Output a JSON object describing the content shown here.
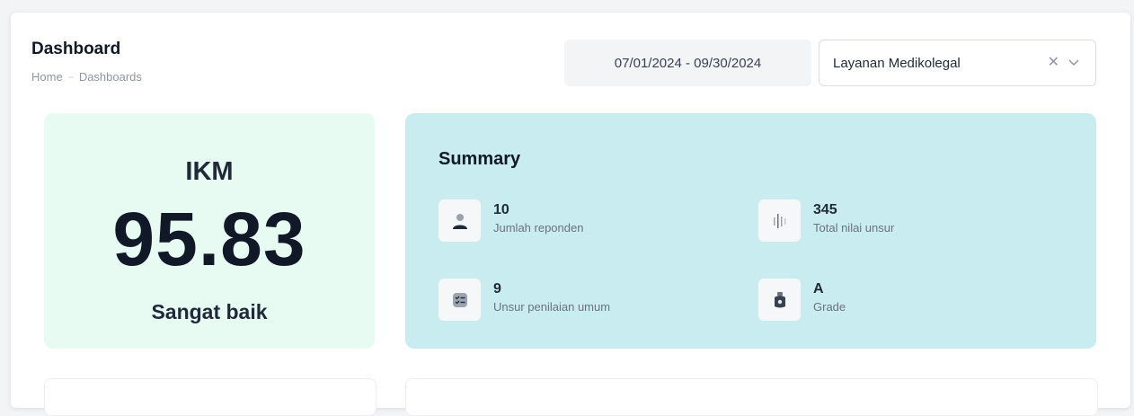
{
  "header": {
    "title": "Dashboard",
    "breadcrumb": [
      "Home",
      "Dashboards"
    ]
  },
  "filters": {
    "date_range": "07/01/2024 - 09/30/2024",
    "service_select": "Layanan Medikolegal",
    "clear_icon": "close-icon",
    "dropdown_icon": "chevron-down-icon"
  },
  "ikm": {
    "label": "IKM",
    "value": "95.83",
    "category": "Sangat baik",
    "bg_color": "#e7fbf2"
  },
  "summary": {
    "title": "Summary",
    "bg_color": "#c8ecf0",
    "items": [
      {
        "value": "10",
        "label": "Jumlah reponden",
        "icon": "user-icon"
      },
      {
        "value": "345",
        "label": "Total nilai unsur",
        "icon": "bars-icon"
      },
      {
        "value": "9",
        "label": "Unsur penilaian umum",
        "icon": "checklist-icon"
      },
      {
        "value": "A",
        "label": "Grade",
        "icon": "badge-icon"
      }
    ]
  }
}
